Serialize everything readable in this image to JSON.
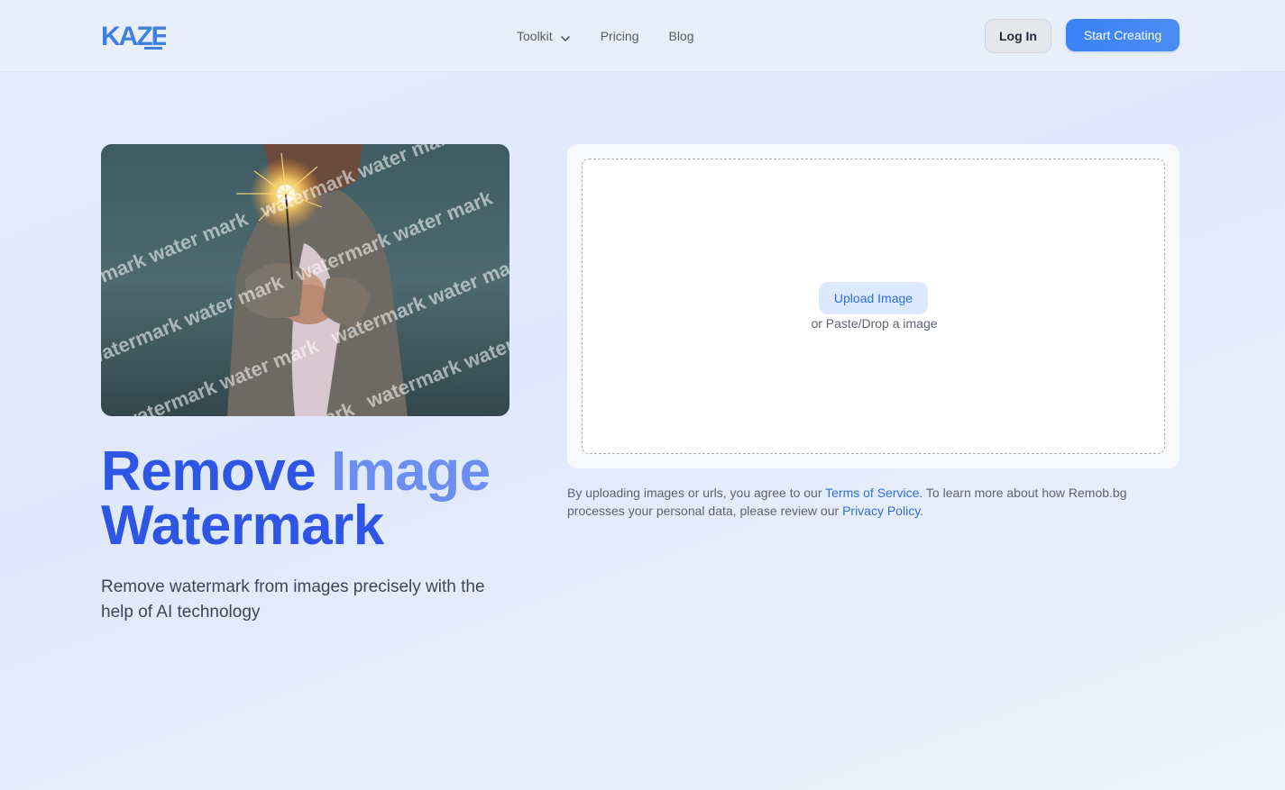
{
  "header": {
    "logo_text": "KAZE",
    "nav": [
      {
        "label": "Toolkit",
        "has_dropdown": true,
        "icon": "chevron-down-icon"
      },
      {
        "label": "Pricing"
      },
      {
        "label": "Blog"
      }
    ],
    "login_label": "Log In",
    "start_label": "Start Creating"
  },
  "hero": {
    "image_alt": "Person holding a lit sparkler, overlaid with watermark text",
    "watermark_text": "watermark water mark",
    "title_part1": "Remove",
    "title_part2": "Image",
    "title_part3": "Watermark",
    "subtitle": "Remove watermark from images precisely with the help of AI technology"
  },
  "upload": {
    "button_label": "Upload Image",
    "hint": "or Paste/Drop a image"
  },
  "terms": {
    "text_before": "By uploading images or urls, you agree to our ",
    "tos_link": "Terms of Service",
    "text_middle": ". To learn more about how Remob.bg processes your personal data, please review our ",
    "privacy_link": "Privacy Policy",
    "text_after": "."
  },
  "colors": {
    "accent": "#3b82f6",
    "title_dark": "#2f55e4",
    "title_light": "#6b8ef0",
    "link": "#2f6fd6"
  }
}
